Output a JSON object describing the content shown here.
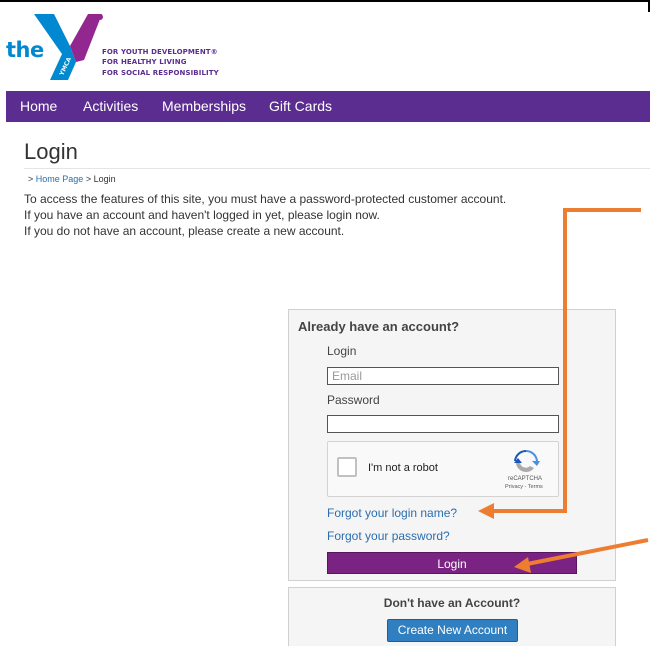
{
  "logo": {
    "the_text": "the",
    "y_letters": "YMCA",
    "taglines": [
      "FOR YOUTH DEVELOPMENT®",
      "FOR HEALTHY LIVING",
      "FOR SOCIAL RESPONSIBILITY"
    ],
    "color_blue": "#0089d0",
    "color_purple": "#92278f"
  },
  "nav": {
    "items": [
      "Home",
      "Activities",
      "Memberships",
      "Gift Cards"
    ],
    "bg_color": "#5c2d91"
  },
  "page": {
    "title": "Login",
    "breadcrumb": {
      "prefix": ">",
      "home": "Home Page",
      "separator": ">",
      "current": "Login"
    },
    "intro": [
      "To access the features of this site, you must have a password-protected customer account.",
      "If you have an account and haven't logged in yet, please login now.",
      "If you do not have an account, please create a new account."
    ]
  },
  "login_panel": {
    "title": "Already have an account?",
    "login_label": "Login",
    "login_placeholder": "Email",
    "login_value": "",
    "password_label": "Password",
    "password_value": "",
    "captcha": {
      "label": "I'm not a robot",
      "brand": "reCAPTCHA",
      "links": "Privacy - Terms",
      "icon": "recaptcha-icon"
    },
    "forgot_login": "Forgot your login name?",
    "forgot_password": "Forgot your password?",
    "login_button": "Login",
    "button_color": "#7b2382"
  },
  "create_panel": {
    "title": "Don't have an Account?",
    "button": "Create New Account",
    "button_color": "#2f7fc1"
  },
  "annotations": {
    "arrow_color": "#ed7d31",
    "arrows": [
      "arrow-to-forgot-login-name",
      "arrow-to-login-button"
    ]
  }
}
